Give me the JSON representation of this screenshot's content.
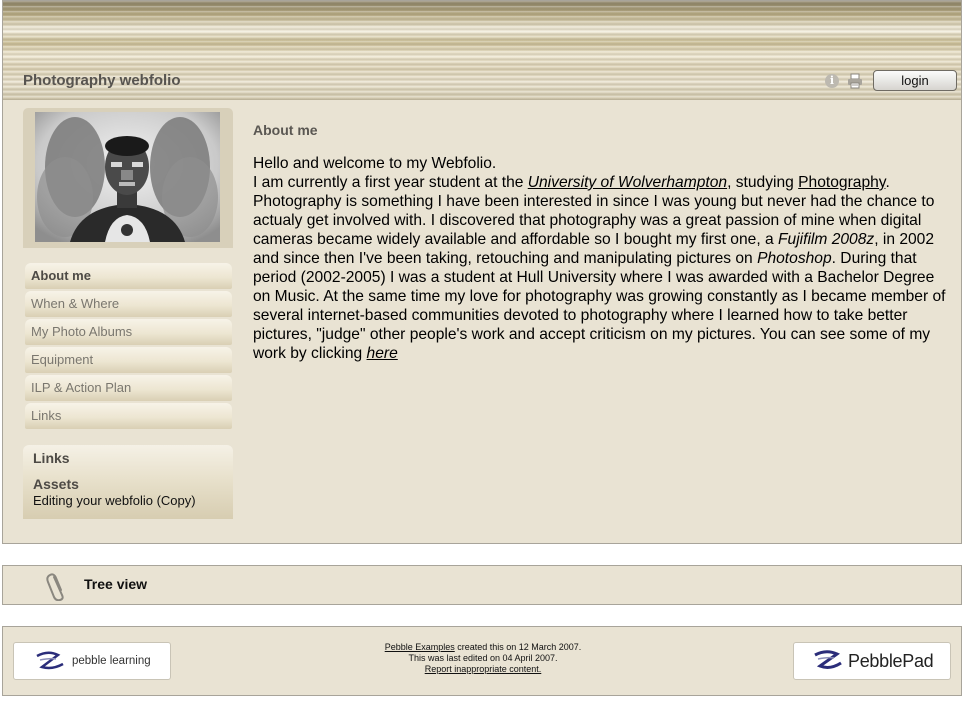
{
  "header": {
    "site_title": "Photography webfolio",
    "login_label": "login",
    "info_icon_glyph": "i"
  },
  "sidebar": {
    "nav_items": [
      {
        "label": "About me",
        "active": true
      },
      {
        "label": "When & Where"
      },
      {
        "label": "My Photo Albums"
      },
      {
        "label": "Equipment"
      },
      {
        "label": "ILP & Action Plan"
      },
      {
        "label": "Links"
      }
    ],
    "links_title": "Links",
    "assets_title": "Assets",
    "asset_link": "Editing your webfolio (Copy)"
  },
  "content": {
    "title": "About me",
    "p1": "Hello and welcome to my Webfolio.",
    "p2_a": "I am currently a first year student at the ",
    "p2_link_university": "University of Wolverhampton",
    "p2_b": ", studying ",
    "p2_link_photography": "Photography",
    "p2_c": ". Photography is something I have been interested in since I was young but never had the chance to actualy get involved with. I discovered that photography was a great passion of mine when digital cameras became widely available and affordable so I bought my first one, a ",
    "p2_camera": "Fujifilm 2008z",
    "p2_d": ", in 2002 and since then I've been taking, retouching and manipulating pictures on ",
    "p2_software": "Photoshop",
    "p2_e": ". During that period (2002-2005) I was a student at Hull University where I was awarded with a Bachelor Degree on Music. At the same time my love for photography was growing constantly as I became member of several internet-based communities devoted to photography where I learned how to take better pictures, \"judge\" other people's work and accept criticism on my pictures. You can see some of my work by clicking ",
    "p2_link_here": "here"
  },
  "tree": {
    "label": "Tree view"
  },
  "footer": {
    "logo_left_text": "pebble learning",
    "logo_right_text": "PebblePad",
    "author_link": "Pebble Examples",
    "created_text": " created this on 12 March 2007.",
    "edited_text": "This was last edited on 04 April 2007.",
    "report_link": "Report inappropriate content."
  },
  "colors": {
    "panel_bg": "#e9e3d3",
    "border": "#a8a49a",
    "title_text": "#575450",
    "nav_text": "#7a776f"
  }
}
